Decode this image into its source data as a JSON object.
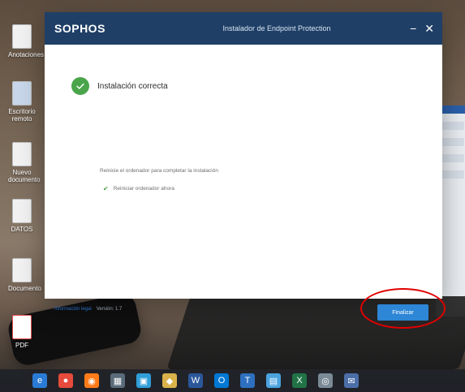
{
  "dialog": {
    "brand": "SOPHOS",
    "title": "Instalador de Endpoint Protection",
    "status": "Instalación correcta",
    "message": "Reinicie el ordenador para completar la instalación",
    "option": "Reiniciar ordenador ahora",
    "legal_link": "Información legal",
    "version": "Versión: 1.7",
    "finish": "Finalizar"
  },
  "desktop": {
    "icons": [
      {
        "label": "Anotaciones"
      },
      {
        "label": "Escritorio remoto"
      },
      {
        "label": "Nuevo documento"
      },
      {
        "label": "DATOS"
      },
      {
        "label": "Documento"
      },
      {
        "label": "PDF"
      }
    ]
  },
  "taskbar": {
    "icons": [
      "edge-icon",
      "chrome-icon",
      "firefox-icon",
      "store-icon",
      "explorer-icon",
      "app-icon",
      "word-icon",
      "outlook-icon",
      "teams-icon",
      "photos-icon",
      "excel-icon",
      "eye-icon",
      "mail-icon"
    ]
  },
  "colors": {
    "titlebar": "#1f3f66",
    "accent": "#2d86d6",
    "success": "#4aa54a",
    "highlight": "#e00000"
  }
}
